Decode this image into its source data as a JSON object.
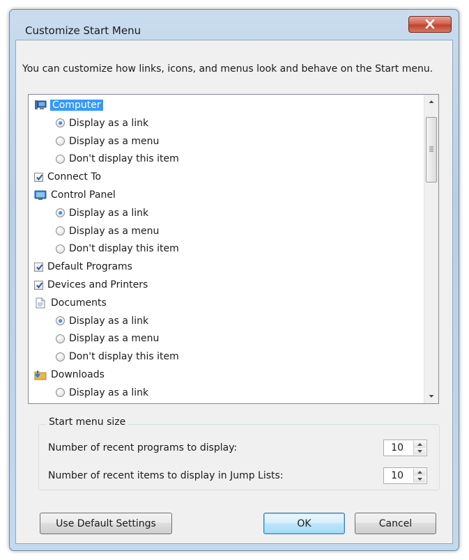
{
  "window": {
    "title": "Customize Start Menu"
  },
  "description": "You can customize how links, icons, and menus look and behave on the Start menu.",
  "list": {
    "items": [
      {
        "type": "header",
        "icon": "computer-icon",
        "label": "Computer",
        "selected": true
      },
      {
        "type": "radio",
        "label": "Display as a link",
        "checked": true
      },
      {
        "type": "radio",
        "label": "Display as a menu",
        "checked": false
      },
      {
        "type": "radio",
        "label": "Don't display this item",
        "checked": false
      },
      {
        "type": "checkbox",
        "label": "Connect To",
        "checked": true
      },
      {
        "type": "header",
        "icon": "control-panel-icon",
        "label": "Control Panel"
      },
      {
        "type": "radio",
        "label": "Display as a link",
        "checked": true
      },
      {
        "type": "radio",
        "label": "Display as a menu",
        "checked": false
      },
      {
        "type": "radio",
        "label": "Don't display this item",
        "checked": false
      },
      {
        "type": "checkbox",
        "label": "Default Programs",
        "checked": true
      },
      {
        "type": "checkbox",
        "label": "Devices and Printers",
        "checked": true
      },
      {
        "type": "header",
        "icon": "documents-icon",
        "label": "Documents"
      },
      {
        "type": "radio",
        "label": "Display as a link",
        "checked": true
      },
      {
        "type": "radio",
        "label": "Display as a menu",
        "checked": false
      },
      {
        "type": "radio",
        "label": "Don't display this item",
        "checked": false
      },
      {
        "type": "header",
        "icon": "downloads-icon",
        "label": "Downloads"
      },
      {
        "type": "radio",
        "label": "Display as a link",
        "checked": false
      }
    ]
  },
  "start_menu_size": {
    "legend": "Start menu size",
    "recent_programs_label": "Number of recent programs to display:",
    "recent_programs_value": "10",
    "jump_list_label": "Number of recent items to display in Jump Lists:",
    "jump_list_value": "10"
  },
  "buttons": {
    "use_default": "Use Default Settings",
    "ok": "OK",
    "cancel": "Cancel"
  }
}
